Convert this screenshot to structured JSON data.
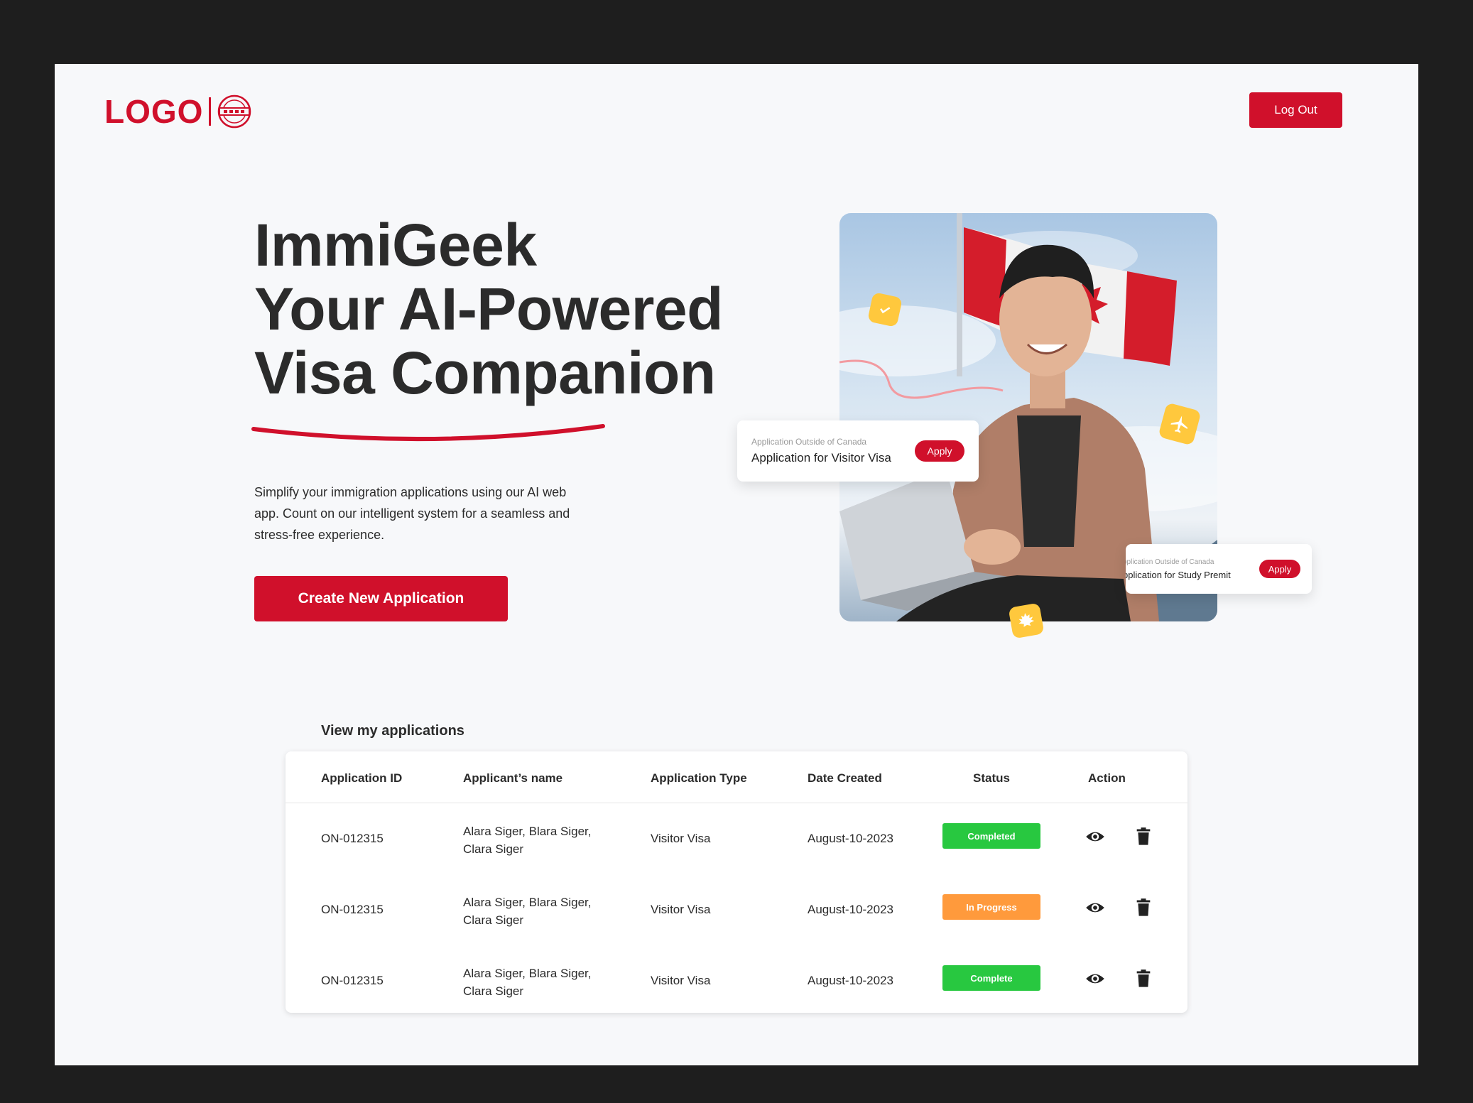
{
  "header": {
    "logo_text": "LOGO",
    "logout_label": "Log Out"
  },
  "hero": {
    "title_lines": [
      "ImmiGeek",
      "Your AI-Powered",
      "Visa Companion"
    ],
    "description": "Simplify your immigration applications using our AI web app. Count on our intelligent system for a seamless and stress-free experience.",
    "cta_label": "Create New Application"
  },
  "floating_cards": [
    {
      "subtitle": "Application Outside of Canada",
      "title": "Application for Visitor Visa",
      "button": "Apply"
    },
    {
      "subtitle": "pplication Outside of Canada",
      "title": "pplication for Study Premit",
      "button": "Apply"
    }
  ],
  "applications": {
    "heading": "View my applications",
    "columns": [
      "Application ID",
      "Applicant’s name",
      "Application Type",
      "Date Created",
      "Status",
      "Action"
    ],
    "rows": [
      {
        "id": "ON-012315",
        "names": "Alara Siger, Blara Siger, Clara Siger",
        "type": "Visitor Visa",
        "date": "August-10-2023",
        "status": "Completed",
        "status_color": "#28c840"
      },
      {
        "id": "ON-012315",
        "names": "Alara Siger, Blara Siger, Clara Siger",
        "type": "Visitor Visa",
        "date": "August-10-2023",
        "status": "In Progress",
        "status_color": "#ff9a3c"
      },
      {
        "id": "ON-012315",
        "names": "Alara Siger, Blara Siger, Clara Siger",
        "type": "Visitor Visa",
        "date": "August-10-2023",
        "status": "Complete",
        "status_color": "#28c840"
      }
    ],
    "action_icons": [
      "eye-icon",
      "trash-icon"
    ]
  },
  "colors": {
    "brand_red": "#d0102b",
    "accent_yellow": "#ffc83d"
  }
}
